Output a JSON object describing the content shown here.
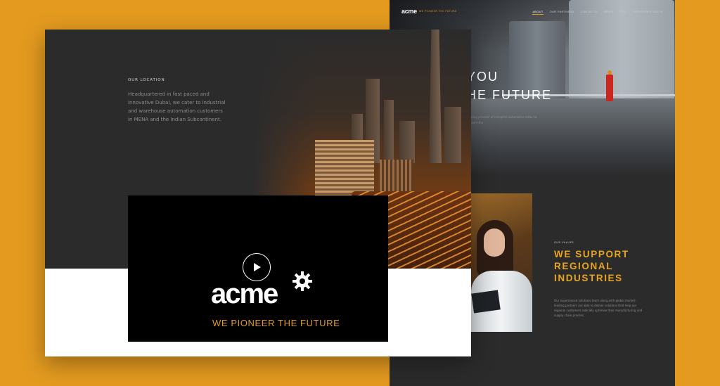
{
  "colors": {
    "background": "#e39a1f",
    "panel": "#2b2b2c",
    "accent": "#e39a1f",
    "heading_accent": "#e9a420",
    "white": "#ffffff"
  },
  "back_page": {
    "nav": {
      "logo": "acme",
      "tagline": "WE PIONEER THE FUTURE",
      "links": [
        "ABOUT",
        "OUR PARTNERS",
        "CONTACTS",
        "NEWS",
        "FAQ",
        "EMPLOYEES LOG IN"
      ]
    },
    "hero": {
      "heading_line1": "YOU",
      "heading_line2": "HE FUTURE",
      "text": "leading provider of complete automation letter to present the"
    },
    "values": {
      "eyebrow": "OUR VALUES",
      "heading": "WE SUPPORT REGIONAL INDUSTRIES",
      "text": "Our experienced solutions team along with global market-leading partners are able to deliver solutions that help our regional customers radically optimise their manufacturing and supply chain process."
    }
  },
  "front_page": {
    "location": {
      "eyebrow": "OUR LOCATION",
      "text": "Headquartered in fast paced and innovative Dubai, we cater to industrial and warehouse automation customers in MENA and the Indian Subcontinent."
    },
    "video": {
      "play_icon": "play-icon",
      "brand": "acme",
      "gear_icon": "gear-icon",
      "tagline": "WE PIONEER THE FUTURE"
    }
  }
}
